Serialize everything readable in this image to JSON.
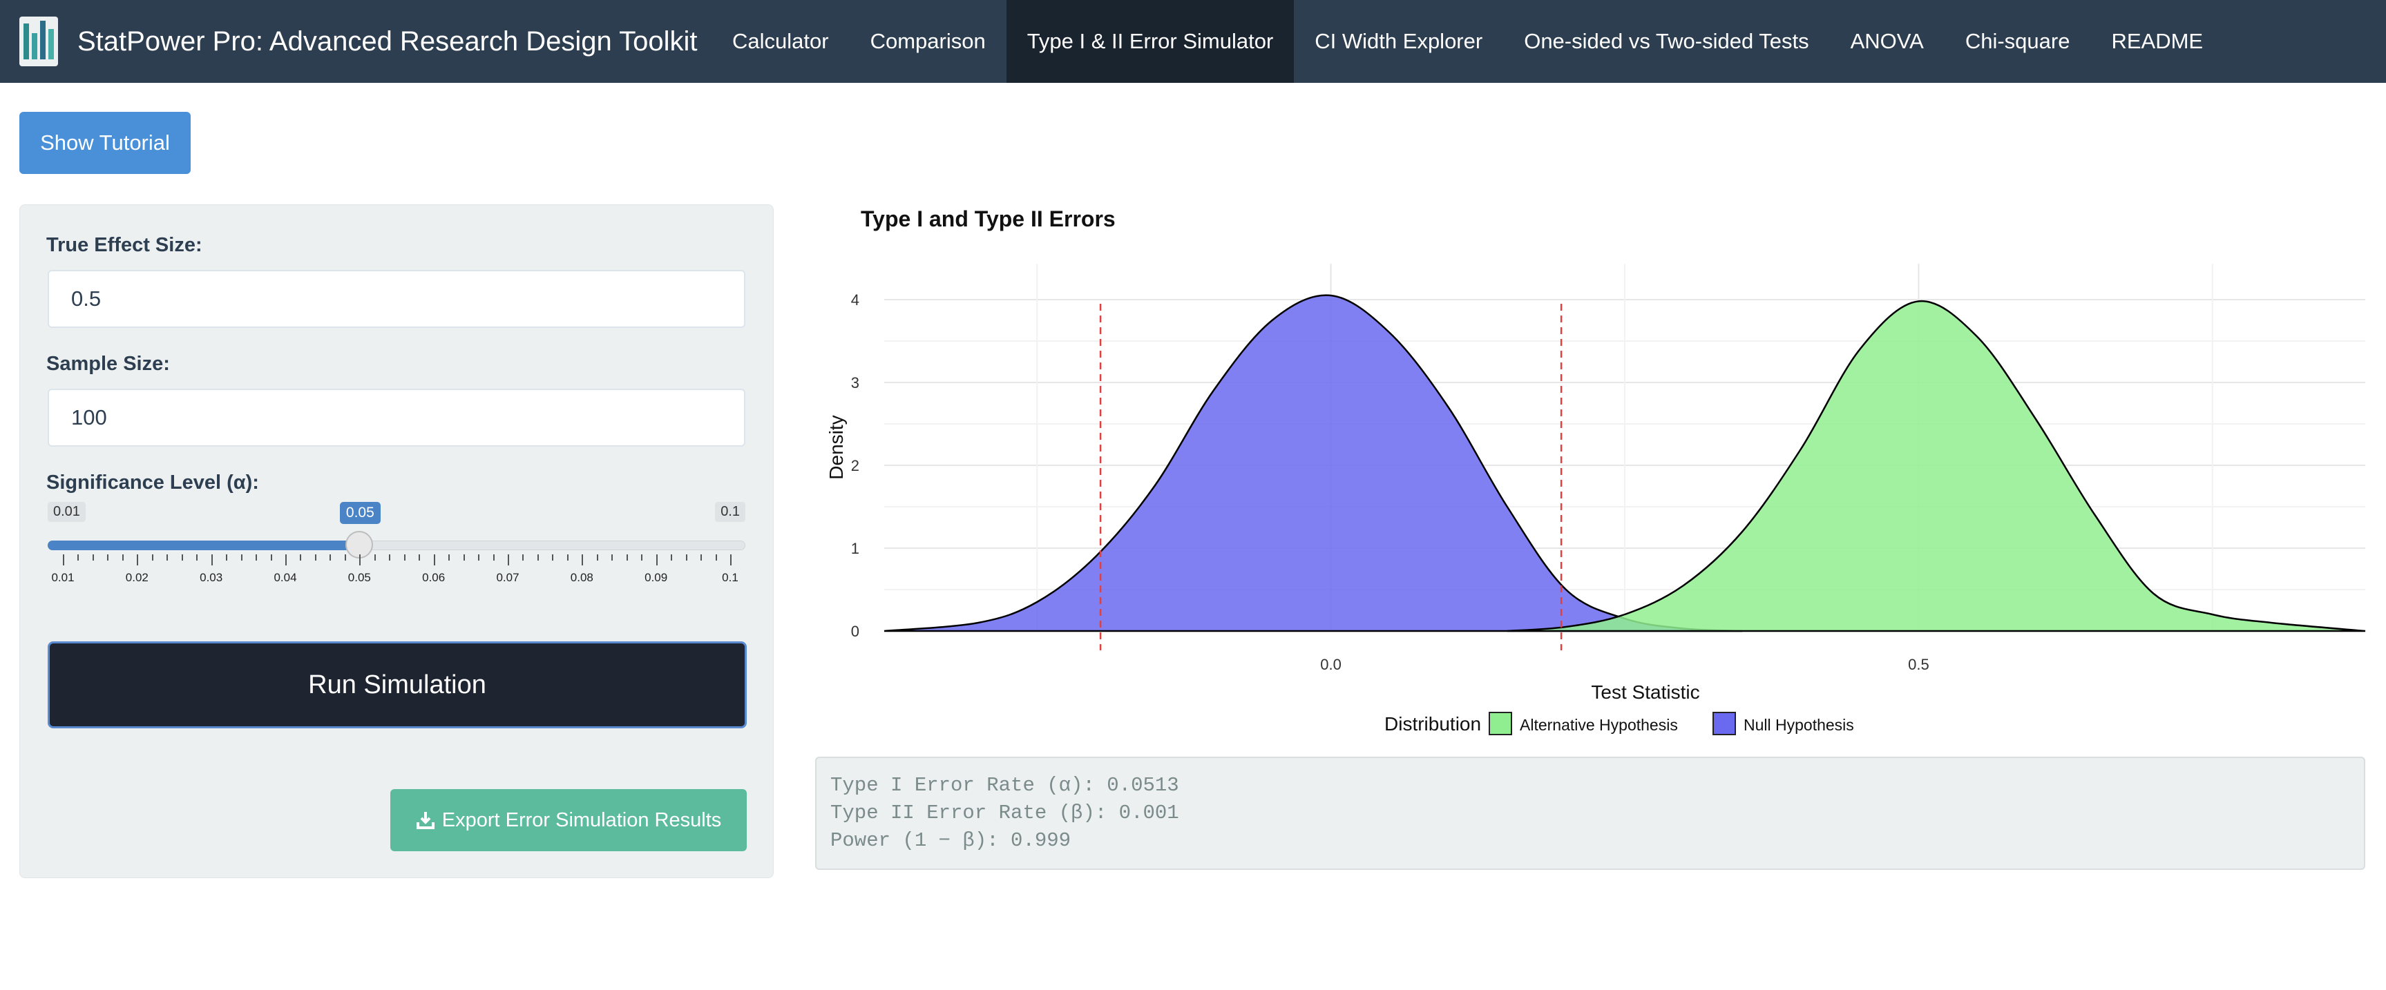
{
  "app": {
    "title": "StatPower Pro: Advanced Research Design Toolkit",
    "logo_icon": "bar-chart-logo-icon"
  },
  "nav": {
    "items": [
      {
        "label": "Calculator",
        "active": false
      },
      {
        "label": "Comparison",
        "active": false
      },
      {
        "label": "Type I & II Error Simulator",
        "active": true
      },
      {
        "label": "CI Width Explorer",
        "active": false
      },
      {
        "label": "One-sided vs Two-sided Tests",
        "active": false
      },
      {
        "label": "ANOVA",
        "active": false
      },
      {
        "label": "Chi-square",
        "active": false
      },
      {
        "label": "README",
        "active": false
      }
    ]
  },
  "tutorial_button": "Show Tutorial",
  "form": {
    "effect_label": "True Effect Size:",
    "effect_value": "0.5",
    "sample_label": "Sample Size:",
    "sample_value": "100",
    "alpha_label": "Significance Level (α):",
    "slider": {
      "min": "0.01",
      "max": "0.1",
      "value": "0.05",
      "fraction": 0.444,
      "ticks": [
        "0.01",
        "0.02",
        "0.03",
        "0.04",
        "0.05",
        "0.06",
        "0.07",
        "0.08",
        "0.09",
        "0.1"
      ]
    },
    "run_button": "Run Simulation",
    "export_button": "Export Error Simulation Results",
    "export_icon": "download-icon"
  },
  "chart_data": {
    "type": "area",
    "title": "Type I and Type II Errors",
    "xlabel": "Test Statistic",
    "ylabel": "Density",
    "xlim": [
      -0.38,
      0.88
    ],
    "ylim": [
      0,
      4.1
    ],
    "x_ticks": [
      "0.0",
      "0.5"
    ],
    "y_ticks": [
      "0",
      "1",
      "2",
      "3",
      "4"
    ],
    "grid": true,
    "critical_values": [
      -0.196,
      0.196
    ],
    "legend": {
      "title": "Distribution",
      "position": "bottom",
      "entries": [
        {
          "label": "Alternative Hypothesis",
          "color": "#90EE90"
        },
        {
          "label": "Null Hypothesis",
          "color": "#6A6AF0"
        }
      ]
    },
    "series": [
      {
        "name": "Null Hypothesis",
        "color": "#6A6AF0",
        "x": [
          -0.38,
          -0.3,
          -0.25,
          -0.2,
          -0.15,
          -0.1,
          -0.05,
          0.0,
          0.05,
          0.1,
          0.15,
          0.2,
          0.25,
          0.3,
          0.35
        ],
        "values": [
          0.0,
          0.1,
          0.35,
          0.9,
          1.75,
          2.9,
          3.75,
          4.05,
          3.6,
          2.7,
          1.5,
          0.5,
          0.15,
          0.03,
          0.0
        ]
      },
      {
        "name": "Alternative Hypothesis",
        "color": "#90EE90",
        "x": [
          0.15,
          0.2,
          0.25,
          0.3,
          0.35,
          0.4,
          0.45,
          0.5,
          0.55,
          0.6,
          0.65,
          0.7,
          0.75,
          0.8,
          0.88
        ],
        "values": [
          0.0,
          0.05,
          0.2,
          0.55,
          1.2,
          2.2,
          3.4,
          3.98,
          3.55,
          2.55,
          1.4,
          0.45,
          0.2,
          0.1,
          0.0
        ]
      }
    ]
  },
  "results": {
    "line1": "Type I Error Rate (α): 0.0513",
    "line2": "Type II Error Rate (β): 0.001",
    "line3": "Power (1 − β): 0.999"
  }
}
